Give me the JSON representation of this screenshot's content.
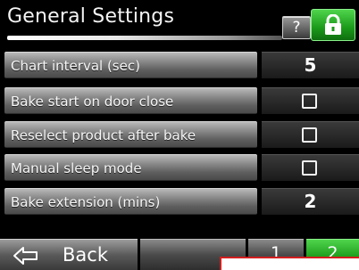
{
  "header": {
    "title": "General Settings",
    "help_label": "?",
    "lock_icon": "lock-icon",
    "lock_color": "#1fae1d"
  },
  "settings": [
    {
      "label": "Chart interval (sec)",
      "type": "number",
      "value": "5"
    },
    {
      "label": "Bake start on door close",
      "type": "checkbox",
      "checked": false
    },
    {
      "label": "Reselect product after bake",
      "type": "checkbox",
      "checked": false
    },
    {
      "label": "Manual sleep mode",
      "type": "checkbox",
      "checked": false
    },
    {
      "label": "Bake extension (mins)",
      "type": "number",
      "value": "2"
    }
  ],
  "footer": {
    "back_label": "Back",
    "back_icon": "back-arrow-icon",
    "pages": [
      {
        "label": "1",
        "active": false
      },
      {
        "label": "2",
        "active": true
      }
    ]
  },
  "colors": {
    "accent_green": "#1fae1d",
    "background": "#000000"
  }
}
